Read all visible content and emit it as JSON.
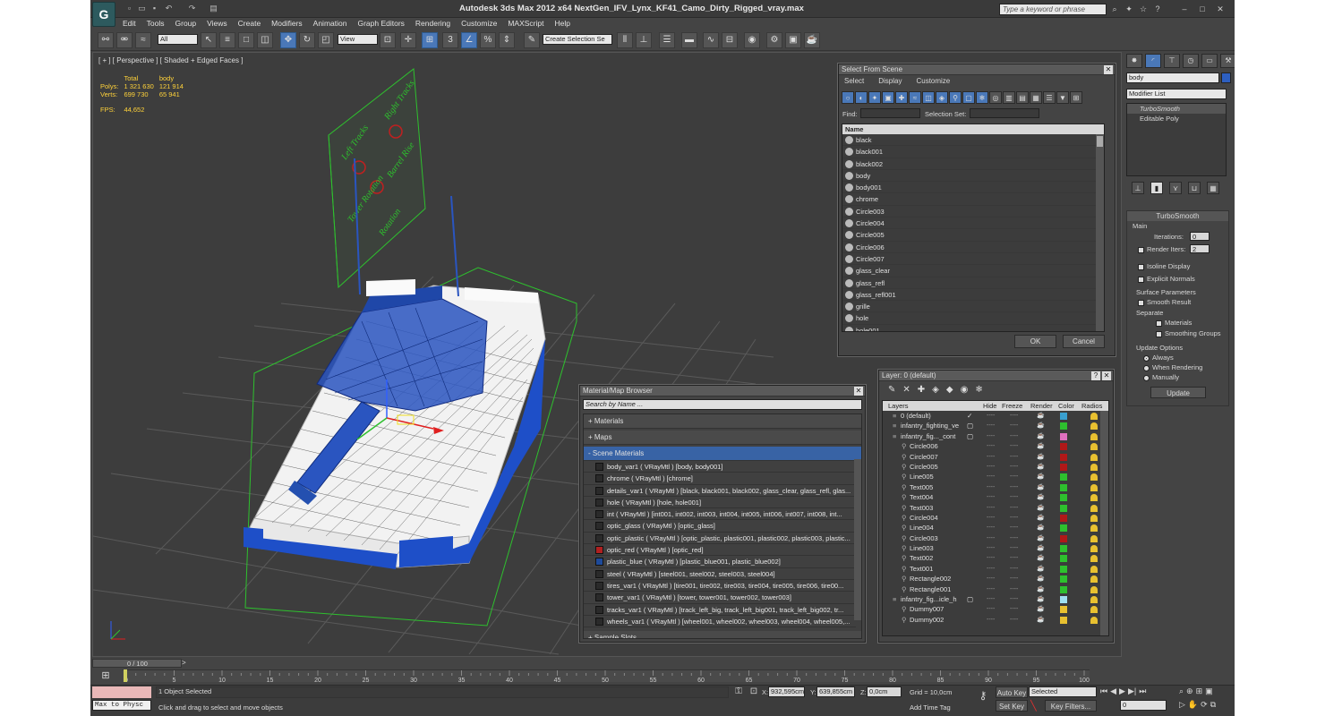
{
  "app": {
    "title": "Autodesk 3ds Max  2012 x64      NextGen_IFV_Lynx_KF41_Camo_Dirty_Rigged_vray.max",
    "search_placeholder": "Type a keyword or phrase"
  },
  "menu": [
    "Edit",
    "Tools",
    "Group",
    "Views",
    "Create",
    "Modifiers",
    "Animation",
    "Graph Editors",
    "Rendering",
    "Customize",
    "MAXScript",
    "Help"
  ],
  "toolbar": {
    "filter_value": "All",
    "refcoord_value": "View",
    "selection_set_placeholder": "Create Selection Se"
  },
  "viewport": {
    "label": "[ + ] [ Perspective ] [ Shaded + Edged Faces ]",
    "stats": {
      "col_total": "Total",
      "col_body": "body",
      "polys_label": "Polys:",
      "polys_total": "1 321 630",
      "polys_body": "121 914",
      "verts_label": "Verts:",
      "verts_total": "699 730",
      "verts_body": "65 941",
      "fps_label": "FPS:",
      "fps_value": "44,652"
    },
    "board_text": [
      "Left Tracks",
      "Right Tracks",
      "Tower Rotation",
      "Barrel Rise",
      "Rotation"
    ]
  },
  "select_from_scene": {
    "title": "Select From Scene",
    "menu": [
      "Select",
      "Display",
      "Customize"
    ],
    "find_label": "Find:",
    "selection_set_label": "Selection Set:",
    "column_name": "Name",
    "items": [
      "black",
      "black001",
      "black002",
      "body",
      "body001",
      "chrome",
      "Circle003",
      "Circle004",
      "Circle005",
      "Circle006",
      "Circle007",
      "glass_clear",
      "glass_refl",
      "glass_refl001",
      "grille",
      "hole",
      "hole001"
    ],
    "ok": "OK",
    "cancel": "Cancel"
  },
  "material_browser": {
    "title": "Material/Map Browser",
    "search_placeholder": "Search by Name ...",
    "sections": [
      "+ Materials",
      "+ Maps",
      "- Scene Materials"
    ],
    "sample_slots": "+ Sample Slots",
    "materials": [
      {
        "text": "body_var1  ( VRayMtl )  [body, body001]",
        "color": "#2a2a2a"
      },
      {
        "text": "chrome  ( VRayMtl )  [chrome]",
        "color": "#2a2a2a"
      },
      {
        "text": "details_var1  ( VRayMtl )  [black, black001, black002, glass_clear, glass_refl, glas...",
        "color": "#2a2a2a"
      },
      {
        "text": "hole  ( VRayMtl )  [hole, hole001]",
        "color": "#2a2a2a"
      },
      {
        "text": "int  ( VRayMtl )  [int001, int002, int003, int004, int005, int006, int007, int008, int...",
        "color": "#2a2a2a"
      },
      {
        "text": "optic_glass  ( VRayMtl )  [optic_glass]",
        "color": "#2a2a2a"
      },
      {
        "text": "optic_plastic  ( VRayMtl )  [optic_plastic, plastic001, plastic002, plastic003, plastic...",
        "color": "#2a2a2a"
      },
      {
        "text": "optic_red  ( VRayMtl )  [optic_red]",
        "color": "#b02020"
      },
      {
        "text": "plastic_blue  ( VRayMtl )  [plastic_blue001, plastic_blue002]",
        "color": "#1e4a9a"
      },
      {
        "text": "steel  ( VRayMtl )  [steel001, steel002, steel003, steel004]",
        "color": "#2a2a2a"
      },
      {
        "text": "tires_var1  ( VRayMtl )  [tire001, tire002, tire003, tire004, tire005, tire006, tire00...",
        "color": "#2a2a2a"
      },
      {
        "text": "tower_var1  ( VRayMtl )  [tower, tower001, tower002, tower003]",
        "color": "#2a2a2a"
      },
      {
        "text": "tracks_var1  ( VRayMtl )  [track_left_big, track_left_big001, track_left_big002, tr...",
        "color": "#2a2a2a"
      },
      {
        "text": "wheels_var1  ( VRayMtl )  [wheel001, wheel002, wheel003, wheel004, wheel005,...",
        "color": "#2a2a2a"
      }
    ]
  },
  "layer_panel": {
    "title": "Layer: 0 (default)",
    "columns": [
      "Layers",
      "Hide",
      "Freeze",
      "Render",
      "Color",
      "Radios"
    ],
    "rows": [
      {
        "name": "0 (default)",
        "indent": 1,
        "color": "#3aa0d0",
        "check": true
      },
      {
        "name": "infantry_fighting_ve",
        "indent": 1,
        "color": "#2ec02e",
        "check": false
      },
      {
        "name": "infantry_fig..._cont",
        "indent": 1,
        "color": "#e070c0",
        "check": false
      },
      {
        "name": "Circle006",
        "indent": 2,
        "color": "#b01818"
      },
      {
        "name": "Circle007",
        "indent": 2,
        "color": "#b01818"
      },
      {
        "name": "Circle005",
        "indent": 2,
        "color": "#b01818"
      },
      {
        "name": "Line005",
        "indent": 2,
        "color": "#2ec02e"
      },
      {
        "name": "Text005",
        "indent": 2,
        "color": "#2ec02e"
      },
      {
        "name": "Text004",
        "indent": 2,
        "color": "#2ec02e"
      },
      {
        "name": "Text003",
        "indent": 2,
        "color": "#2ec02e"
      },
      {
        "name": "Circle004",
        "indent": 2,
        "color": "#b01818"
      },
      {
        "name": "Line004",
        "indent": 2,
        "color": "#2ec02e"
      },
      {
        "name": "Circle003",
        "indent": 2,
        "color": "#b01818"
      },
      {
        "name": "Line003",
        "indent": 2,
        "color": "#2ec02e"
      },
      {
        "name": "Text002",
        "indent": 2,
        "color": "#2ec02e"
      },
      {
        "name": "Text001",
        "indent": 2,
        "color": "#2ec02e"
      },
      {
        "name": "Rectangle002",
        "indent": 2,
        "color": "#2ec02e"
      },
      {
        "name": "Rectangle001",
        "indent": 2,
        "color": "#2ec02e"
      },
      {
        "name": "infantry_fig...icle_h",
        "indent": 1,
        "color": "#a0e0f0",
        "check": false
      },
      {
        "name": "Dummy007",
        "indent": 2,
        "color": "#e8c030"
      },
      {
        "name": "Dummy002",
        "indent": 2,
        "color": "#e8c030"
      }
    ]
  },
  "command_panel": {
    "object_name": "body",
    "modifier_list": "Modifier List",
    "stack": [
      "TurboSmooth",
      "Editable Poly"
    ],
    "turbosmooth": {
      "title": "TurboSmooth",
      "main": "Main",
      "iterations_label": "Iterations:",
      "iterations_value": "0",
      "render_iters_label": "Render Iters:",
      "render_iters_value": "2",
      "isoline": "Isoline Display",
      "explicit": "Explicit Normals",
      "surface": "Surface Parameters",
      "smooth_result": "Smooth Result",
      "separate": "Separate",
      "materials": "Materials",
      "smoothing_groups": "Smoothing Groups",
      "update_options": "Update Options",
      "always": "Always",
      "when_rendering": "When Rendering",
      "manually": "Manually",
      "update": "Update"
    }
  },
  "timeline": {
    "frame": "0 / 100",
    "ticks": [
      "0",
      "5",
      "10",
      "15",
      "20",
      "25",
      "30",
      "35",
      "40",
      "45",
      "50",
      "55",
      "60",
      "65",
      "70",
      "75",
      "80",
      "85",
      "90",
      "95",
      "100"
    ]
  },
  "status": {
    "maxscript": "Max to Physc",
    "selected": "1 Object Selected",
    "prompt": "Click and drag to select and move objects",
    "x_label": "X:",
    "x": "932,595cm",
    "y_label": "Y:",
    "y": "639,855cm",
    "z_label": "Z:",
    "z": "0,0cm",
    "grid": "Grid = 10,0cm",
    "add_time_tag": "Add Time Tag",
    "auto_key": "Auto Key",
    "set_key": "Set Key",
    "selected_dd": "Selected",
    "key_filters": "Key Filters...",
    "frame_field": "0"
  },
  "colors": {
    "accent": "#4a78b8",
    "wire": "#1e4fc8",
    "board": "#2ec02e"
  }
}
